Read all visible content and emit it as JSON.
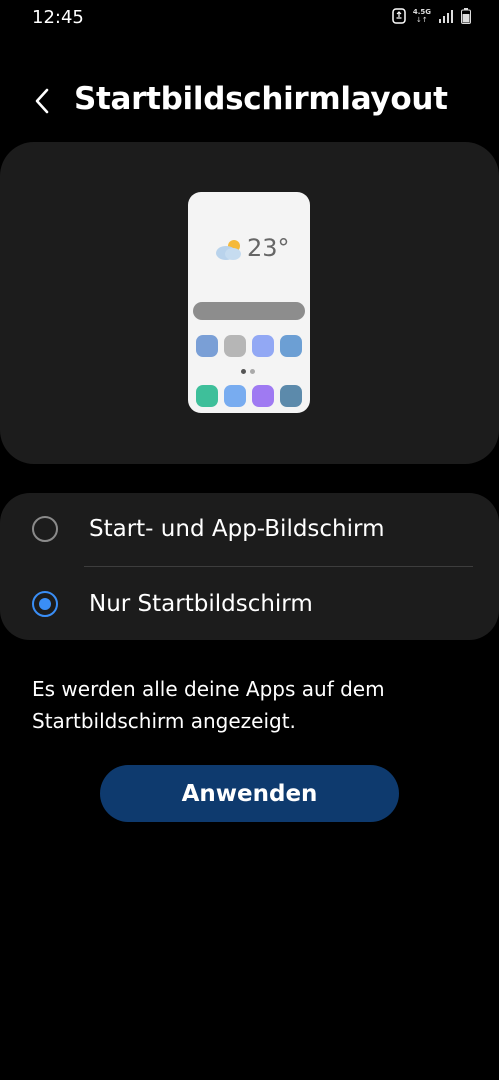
{
  "status_bar": {
    "time": "12:45",
    "network_type": "4.5G",
    "network_arrows": "↓↑"
  },
  "header": {
    "title": "Startbildschirmlayout"
  },
  "preview": {
    "temperature": "23°",
    "row1_colors": [
      "#7a9fd6",
      "#b6b6b6",
      "#92a8f4",
      "#6c9fd4"
    ],
    "row2_colors": [
      "#3ebf9a",
      "#78acf0",
      "#9f7af2",
      "#5c8aab"
    ]
  },
  "options": [
    {
      "label": "Start- und App-Bildschirm",
      "selected": false
    },
    {
      "label": "Nur Startbildschirm",
      "selected": true
    }
  ],
  "description": "Es werden alle deine Apps auf dem Startbildschirm angezeigt.",
  "apply_button": {
    "label": "Anwenden"
  },
  "colors": {
    "accent": "#3a8ef6",
    "button_bg": "#0e3a6e",
    "card_bg": "#1c1c1c"
  }
}
